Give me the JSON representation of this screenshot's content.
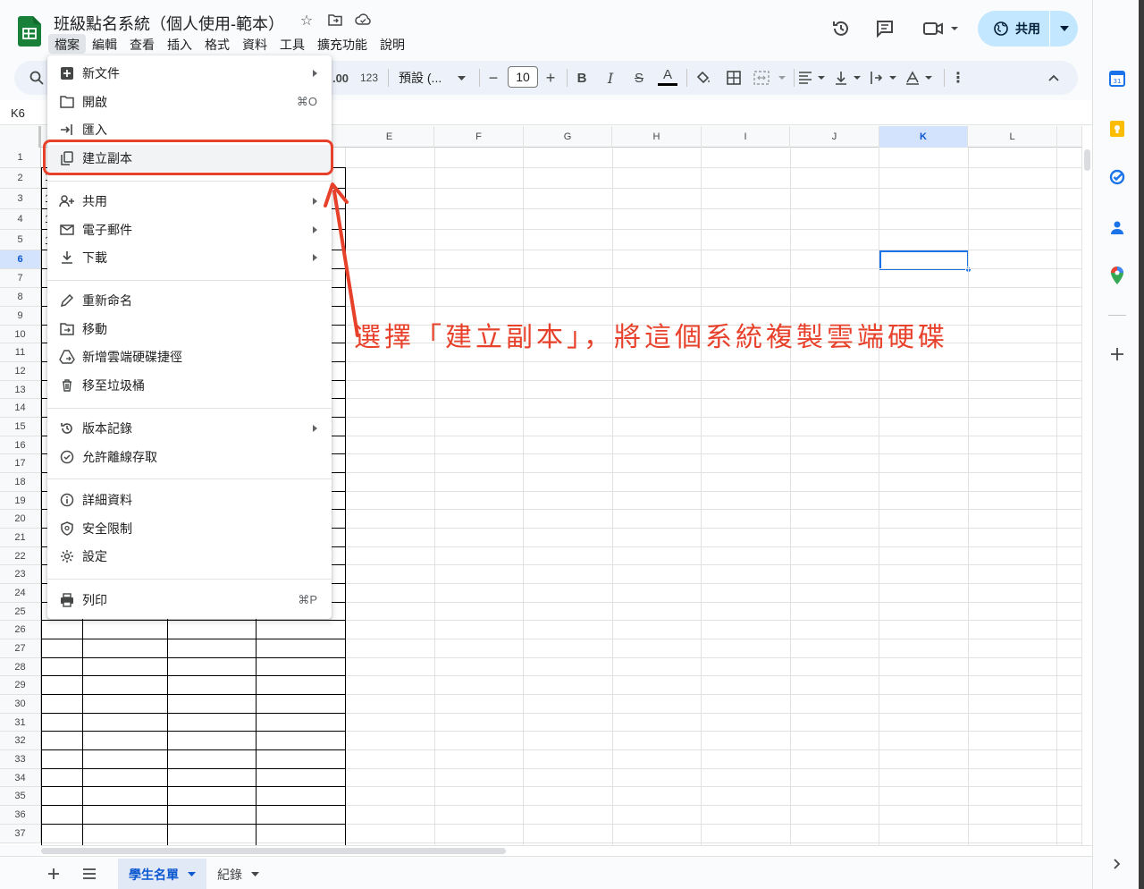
{
  "app": {
    "title": "班級點名系統（個人使用-範本）",
    "menu": [
      "檔案",
      "編輯",
      "查看",
      "插入",
      "格式",
      "資料",
      "工具",
      "擴充功能",
      "說明"
    ],
    "share_label": "共用"
  },
  "toolbar": {
    "decimal_label": ".00",
    "number_format": "123",
    "font_name": "預設 (...",
    "font_size": "10",
    "minus": "−",
    "plus": "+",
    "bold": "B",
    "italic": "I",
    "strike": "S",
    "text_color": "A"
  },
  "formula_bar": {
    "name_box": "K6"
  },
  "grid": {
    "columns": [
      "E",
      "F",
      "G",
      "H",
      "I",
      "J",
      "K",
      "L"
    ],
    "selected_column": "K",
    "rows": [
      "1",
      "2",
      "3",
      "4",
      "5",
      "6",
      "7",
      "8",
      "9",
      "10",
      "11",
      "12",
      "13",
      "14",
      "15",
      "16",
      "17",
      "18",
      "19",
      "20",
      "21",
      "22",
      "23",
      "24",
      "25",
      "26",
      "27",
      "28",
      "29",
      "30",
      "31",
      "32",
      "33",
      "34",
      "35",
      "36",
      "37"
    ],
    "selected_row": "6",
    "partial_cells": [
      "1",
      "1",
      "1",
      "1"
    ]
  },
  "file_menu": {
    "items": [
      {
        "label": "新文件",
        "icon": "new-doc-icon",
        "submenu": true
      },
      {
        "label": "開啟",
        "icon": "folder-open-icon",
        "shortcut": "⌘O"
      },
      {
        "label": "匯入",
        "icon": "import-icon"
      },
      {
        "label": "建立副本",
        "icon": "copy-icon"
      },
      {
        "label": "共用",
        "icon": "person-add-icon",
        "submenu": true
      },
      {
        "label": "電子郵件",
        "icon": "email-icon",
        "submenu": true
      },
      {
        "label": "下載",
        "icon": "download-icon",
        "submenu": true
      },
      {
        "label": "重新命名",
        "icon": "pencil-icon"
      },
      {
        "label": "移動",
        "icon": "move-folder-icon"
      },
      {
        "label": "新增雲端硬碟捷徑",
        "icon": "drive-shortcut-icon"
      },
      {
        "label": "移至垃圾桶",
        "icon": "trash-icon"
      },
      {
        "label": "版本記錄",
        "icon": "history-icon",
        "submenu": true
      },
      {
        "label": "允許離線存取",
        "icon": "offline-check-icon"
      },
      {
        "label": "詳細資料",
        "icon": "info-icon"
      },
      {
        "label": "安全限制",
        "icon": "shield-icon"
      },
      {
        "label": "設定",
        "icon": "gear-icon"
      },
      {
        "label": "列印",
        "icon": "print-icon",
        "shortcut": "⌘P"
      }
    ]
  },
  "sheets": {
    "tabs": [
      "學生名單",
      "紀錄"
    ],
    "active": "學生名單"
  },
  "annotation": {
    "text": "選擇「建立副本」，將這個系統複製雲端硬碟",
    "color": "#e8412b"
  },
  "colors": {
    "accent": "#0b57d0",
    "share_bg": "#c2e7ff",
    "sheets_green": "#188038",
    "selection": "#1a73e8"
  }
}
